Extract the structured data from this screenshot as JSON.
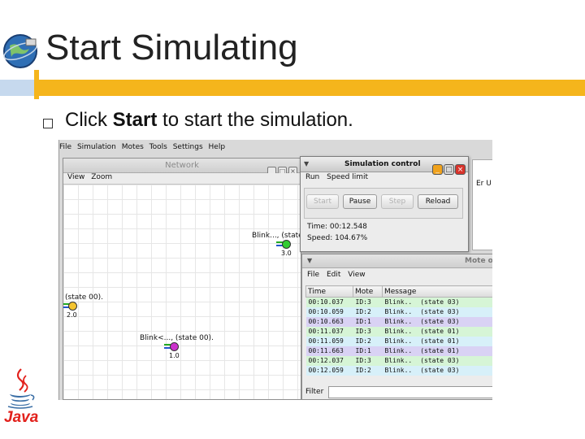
{
  "slide": {
    "title": "Start Simulating",
    "bullet_prefix": "Click ",
    "bullet_bold": "Start",
    "bullet_suffix": " to start the simulation."
  },
  "colors": {
    "accent_bar": "#f5b51c",
    "side_bar": "#c6d9ee",
    "mote_yellow": "#f4c430",
    "mote_green": "#33cc33",
    "mote_magenta": "#cc33cc"
  },
  "app": {
    "menu": [
      "File",
      "Simulation",
      "Motes",
      "Tools",
      "Settings",
      "Help"
    ],
    "network": {
      "title": "Network",
      "menu": [
        "View",
        "Zoom"
      ],
      "motes": [
        {
          "label": "Blink..., (state",
          "id": "3.0",
          "color": "#33cc33"
        },
        {
          "label": "(state 00).",
          "id": "2.0",
          "color": "#f4c430"
        },
        {
          "label": "Blink<..., (state 00).",
          "id": "1.0",
          "color": "#cc33cc"
        }
      ]
    },
    "simulation_control": {
      "title": "Simulation control",
      "menu": [
        "Run",
        "Speed limit"
      ],
      "buttons": {
        "start": "Start",
        "pause": "Pause",
        "step": "Step",
        "reload": "Reload"
      },
      "time": "Time: 00:12.548",
      "speed": "Speed: 104.67%"
    },
    "right_pane_text": "Er U",
    "mote_output": {
      "title": "Mote o",
      "menu": [
        "File",
        "Edit",
        "View"
      ],
      "columns": [
        "Time",
        "Mote",
        "Message"
      ],
      "rows": [
        {
          "time": "00:10.037",
          "mote": "ID:3",
          "msg": "Blink..",
          "state": "(state 03)",
          "bg": "#d6f5d6"
        },
        {
          "time": "00:10.059",
          "mote": "ID:2",
          "msg": "Blink..",
          "state": "(state 03)",
          "bg": "#d7f0f9"
        },
        {
          "time": "00:10.663",
          "mote": "ID:1",
          "msg": "Blink..",
          "state": "(state 03)",
          "bg": "#d9d2f4"
        },
        {
          "time": "00:11.037",
          "mote": "ID:3",
          "msg": "Blink..",
          "state": "(state 01)",
          "bg": "#d6f5d6"
        },
        {
          "time": "00:11.059",
          "mote": "ID:2",
          "msg": "Blink..",
          "state": "(state 01)",
          "bg": "#d7f0f9"
        },
        {
          "time": "00:11.663",
          "mote": "ID:1",
          "msg": "Blink..",
          "state": "(state 01)",
          "bg": "#d9d2f4"
        },
        {
          "time": "00:12.037",
          "mote": "ID:3",
          "msg": "Blink..",
          "state": "(state 03)",
          "bg": "#d6f5d6"
        },
        {
          "time": "00:12.059",
          "mote": "ID:2",
          "msg": "Blink..",
          "state": "(state 03)",
          "bg": "#d7f0f9"
        }
      ],
      "filter_label": "Filter",
      "filter_value": ""
    }
  },
  "branding": {
    "java": "Java"
  }
}
